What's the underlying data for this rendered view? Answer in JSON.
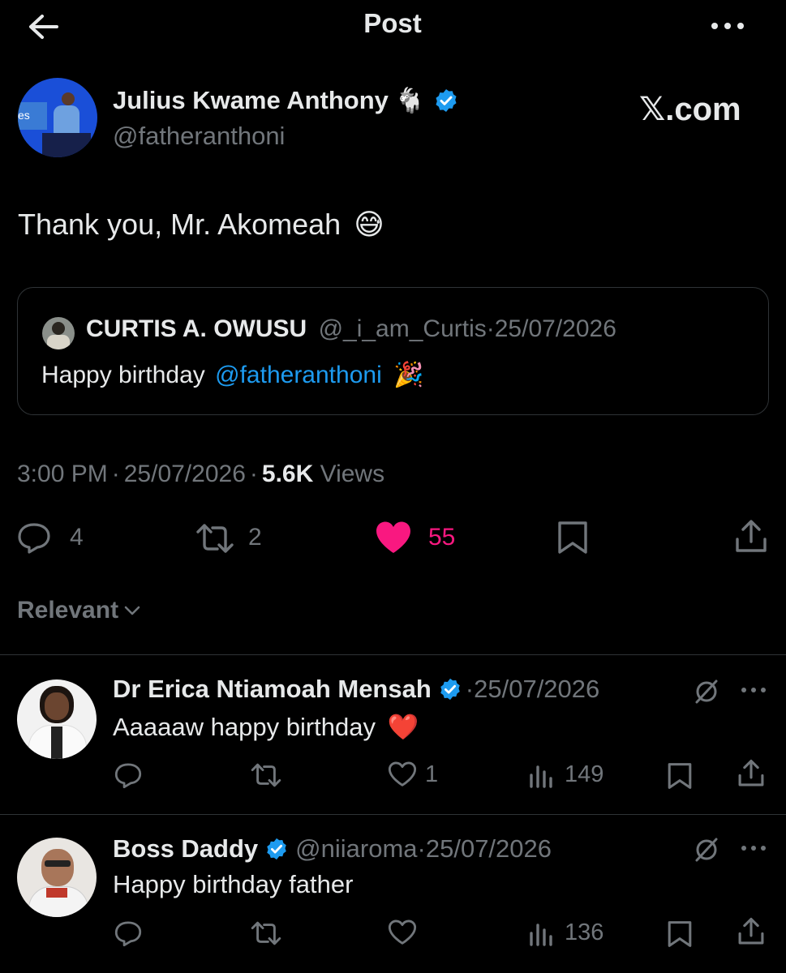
{
  "header": {
    "title": "Post"
  },
  "author": {
    "name": "Julius Kwame Anthony",
    "name_emoji": "🐐",
    "handle": "@fatheranthoni",
    "avatar_text": "es"
  },
  "watermark": "𝕏.com",
  "post": {
    "text": "Thank you, Mr. Akomeah",
    "emoji": "😅"
  },
  "quote": {
    "name": "CURTIS A. OWUSU",
    "handle": "@_i_am_Curtis",
    "sep": "·",
    "date": "25/07/2026",
    "text": "Happy birthday",
    "mention": "@fatheranthoni",
    "emoji": "🎉"
  },
  "meta": {
    "time": "3:00 PM",
    "sep1": "·",
    "date": "25/07/2026",
    "sep2": "·",
    "views_count": "5.6K",
    "views_label": "Views"
  },
  "actions": {
    "replies": "4",
    "reposts": "2",
    "likes": "55"
  },
  "colors": {
    "like": "#f91880",
    "link": "#1d9bf0",
    "verified": "#1d9bf0"
  },
  "sort": {
    "label": "Relevant"
  },
  "replies": [
    {
      "name": "Dr Erica Ntiamoah Mensah",
      "date": "·25/07/2026",
      "text": "Aaaaaw happy birthday",
      "emoji": "❤️",
      "likes": "1",
      "views": "149"
    },
    {
      "name": "Boss Daddy",
      "handle": "@niiaroma",
      "date": "·25/07/2026",
      "text": "Happy birthday father",
      "views": "136"
    }
  ]
}
